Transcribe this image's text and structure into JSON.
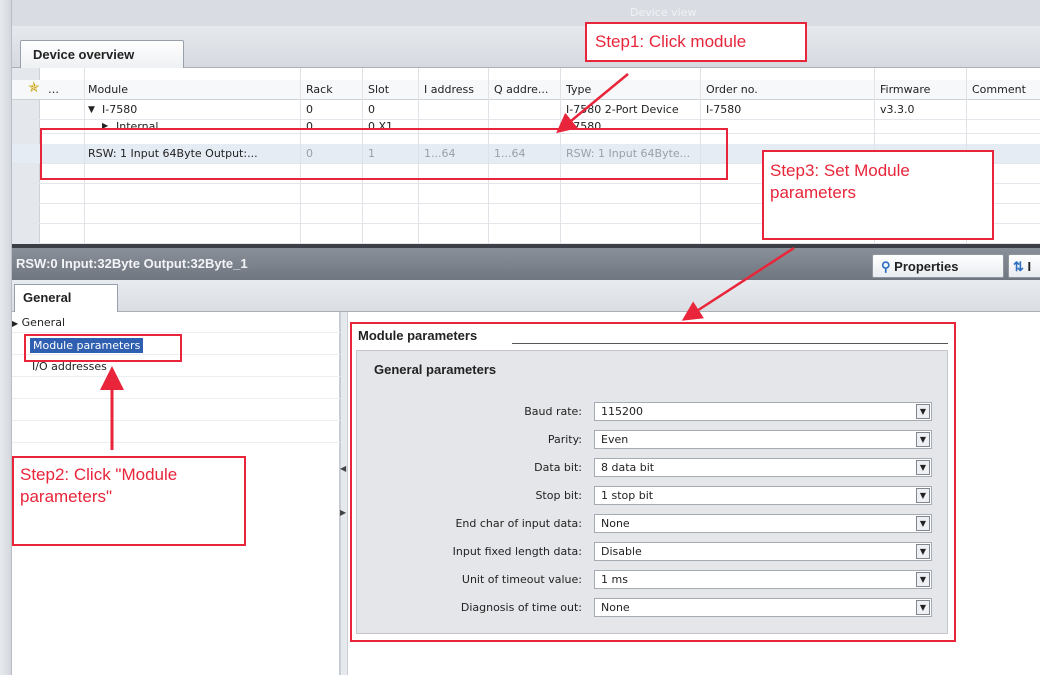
{
  "window_title": "Device view",
  "tab": "Device overview",
  "table": {
    "columns": [
      "Module",
      "Rack",
      "Slot",
      "I address",
      "Q addre...",
      "Type",
      "Order no.",
      "Firmware",
      "Comment"
    ],
    "rows": [
      {
        "module": "I-7580",
        "rack": "0",
        "slot": "0",
        "i_address": "",
        "q_address": "",
        "type": "I-7580 2-Port Device",
        "order_no": "I-7580",
        "firmware": "v3.3.0",
        "comment": ""
      },
      {
        "module": "Internal",
        "rack": "0",
        "slot": "0 X1",
        "i_address": "",
        "q_address": "",
        "type": "I-7580",
        "order_no": "",
        "firmware": "",
        "comment": ""
      },
      {
        "module": "RSW: 1 Input 64Byte Output:...",
        "rack": "0",
        "slot": "1",
        "i_address": "1...64",
        "q_address": "1...64",
        "type": "RSW: 1 Input 64Byte...",
        "order_no": "",
        "firmware": "",
        "comment": ""
      }
    ]
  },
  "properties": {
    "title": "RSW:0 Input:32Byte Output:32Byte_1",
    "properties_tab": "Properties",
    "info_tab": "I",
    "general_tab": "General"
  },
  "nav": {
    "general": "General",
    "module_parameters": "Module parameters",
    "io_addresses": "I/O addresses"
  },
  "params": {
    "section_title": "Module parameters",
    "group_title": "General parameters",
    "fields": [
      {
        "label": "Baud rate:",
        "value": "115200"
      },
      {
        "label": "Parity:",
        "value": "Even"
      },
      {
        "label": "Data bit:",
        "value": "8 data bit"
      },
      {
        "label": "Stop bit:",
        "value": "1 stop bit"
      },
      {
        "label": "End char of input data:",
        "value": "None"
      },
      {
        "label": "Input fixed length data:",
        "value": "Disable"
      },
      {
        "label": "Unit of timeout value:",
        "value": "1 ms"
      },
      {
        "label": "Diagnosis of time out:",
        "value": "None"
      }
    ]
  },
  "annotations": {
    "step1": "Step1: Click module",
    "step2": "Step2: Click \"Module parameters\"",
    "step3": "Step3: Set Module parameters"
  },
  "colors": {
    "annotation": "#e8253a",
    "selection": "#2f5fb0"
  }
}
